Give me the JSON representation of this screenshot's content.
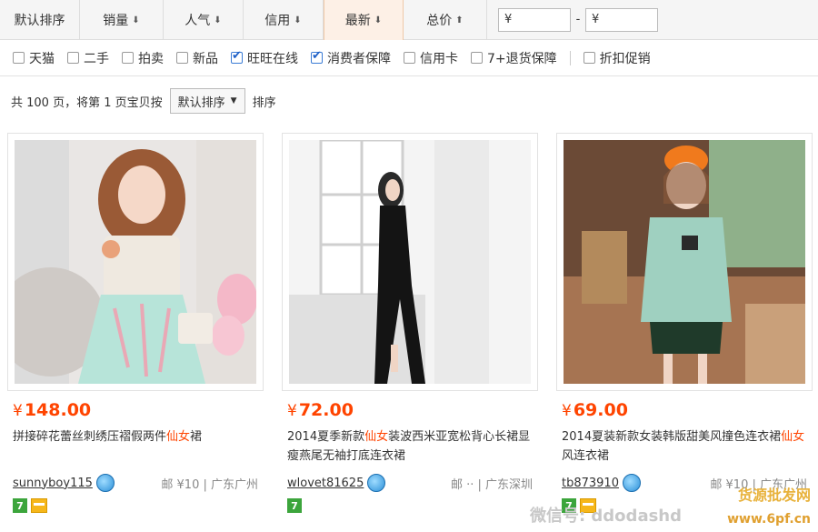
{
  "sort_bar": {
    "buttons": [
      {
        "label": "默认排序",
        "arrow": ""
      },
      {
        "label": "销量",
        "arrow": "⬇"
      },
      {
        "label": "人气",
        "arrow": "⬇"
      },
      {
        "label": "信用",
        "arrow": "⬇"
      },
      {
        "label": "最新",
        "arrow": "⬇"
      },
      {
        "label": "总价",
        "arrow": "⬆"
      }
    ],
    "price_min_placeholder": "¥",
    "price_dash": "-",
    "price_max_placeholder": "¥"
  },
  "filters": [
    {
      "label": "天猫",
      "checked": false
    },
    {
      "label": "二手",
      "checked": false
    },
    {
      "label": "拍卖",
      "checked": false
    },
    {
      "label": "新品",
      "checked": false
    },
    {
      "label": "旺旺在线",
      "checked": true
    },
    {
      "label": "消费者保障",
      "checked": true
    },
    {
      "label": "信用卡",
      "checked": false
    },
    {
      "label": "7+退货保障",
      "checked": false
    },
    {
      "label": "折扣促销",
      "checked": false
    }
  ],
  "pager": {
    "prefix": "共 100 页，将第 1 页宝贝按",
    "sort_value": "默认排序",
    "suffix": "排序"
  },
  "products": [
    {
      "price_symbol": "¥",
      "price": "148.00",
      "title_before": "拼接碎花蕾丝刺绣压褶假两件",
      "title_highlight": "仙女",
      "title_after": "裙",
      "seller": "sunnyboy115",
      "shipping": "邮 ¥10 | 广东广州"
    },
    {
      "price_symbol": "¥",
      "price": "72.00",
      "title_before": "2014夏季新款",
      "title_highlight": "仙女",
      "title_after": "装波西米亚宽松背心长裙显瘦燕尾无袖打底连衣裙",
      "seller": "wlovet81625",
      "shipping": "邮 ·· | 广东深圳"
    },
    {
      "price_symbol": "¥",
      "price": "69.00",
      "title_before": "2014夏装新款女装韩版甜美风撞色连衣裙",
      "title_highlight": "仙女",
      "title_after": "风连衣裙",
      "seller": "tb873910",
      "shipping": "邮 ¥10 | 广东广州"
    }
  ],
  "watermark": {
    "wechat": "微信号: ddodashd",
    "site_cn": "货源批发网",
    "site": "www.6pf.cn"
  },
  "colors": {
    "price": "#ff4400",
    "active_sort_bg": "#fdf0e6"
  }
}
